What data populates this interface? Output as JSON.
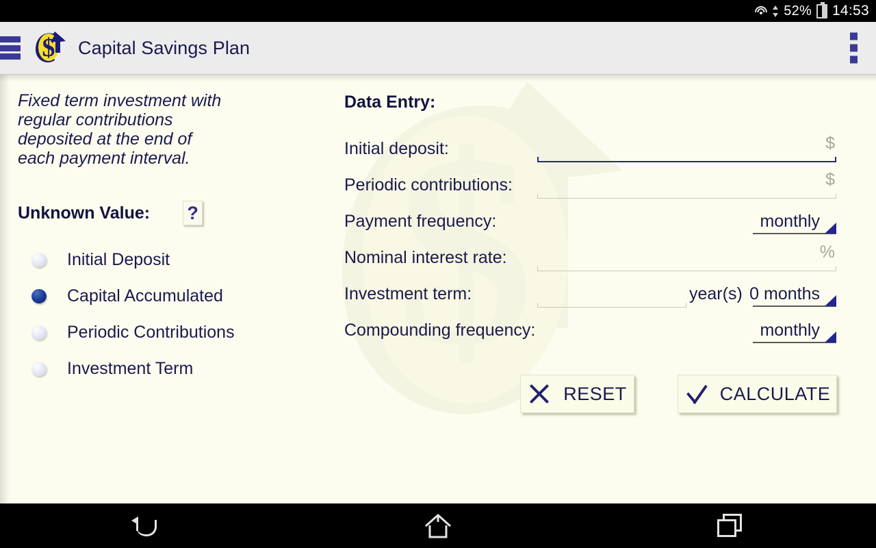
{
  "statusbar": {
    "wifi_icon": "wifi-icon",
    "data_arrows_icon": "data-transfer-arrows-icon",
    "battery_percent": "52%",
    "battery_icon": "battery-icon",
    "time": "14:53"
  },
  "appbar": {
    "menu_icon": "hamburger-menu-icon",
    "logo_icon": "dollar-arrow-logo-icon",
    "title": "Capital Savings Plan",
    "overflow_icon": "overflow-menu-icon"
  },
  "left_panel": {
    "description": "Fixed term investment with regular contributions deposited at the end of each payment interval.",
    "unknown_value_title": "Unknown Value:",
    "help_label": "?",
    "options": [
      {
        "label": "Initial Deposit",
        "selected": false
      },
      {
        "label": "Capital Accumulated",
        "selected": true
      },
      {
        "label": "Periodic Contributions",
        "selected": false
      },
      {
        "label": "Investment Term",
        "selected": false
      }
    ]
  },
  "form": {
    "title": "Data Entry:",
    "rows": {
      "initial_deposit": {
        "label": "Initial deposit:",
        "value": "",
        "suffix": "$",
        "focused": true
      },
      "periodic_contributions": {
        "label": "Periodic contributions:",
        "value": "",
        "suffix": "$",
        "focused": false
      },
      "payment_frequency": {
        "label": "Payment frequency:",
        "value": "monthly"
      },
      "nominal_interest_rate": {
        "label": "Nominal interest rate:",
        "value": "",
        "suffix": "%",
        "focused": false
      },
      "investment_term": {
        "label": "Investment term:",
        "value": "",
        "units": "year(s)",
        "months_value": "0 months"
      },
      "compounding_frequency": {
        "label": "Compounding frequency:",
        "value": "monthly"
      }
    },
    "buttons": {
      "reset": {
        "label": "RESET",
        "icon": "close-x-icon"
      },
      "calculate": {
        "label": "CALCULATE",
        "icon": "checkmark-icon"
      }
    }
  },
  "navbar": {
    "back": "back-icon",
    "home": "home-icon",
    "recents": "recent-apps-icon"
  },
  "colors": {
    "accent_navy": "#25258e",
    "text_navy": "#1a1a4e",
    "content_bg": "#fdfdef",
    "appbar_bg": "#ececec",
    "logo_yellow": "#f5dd2a"
  }
}
